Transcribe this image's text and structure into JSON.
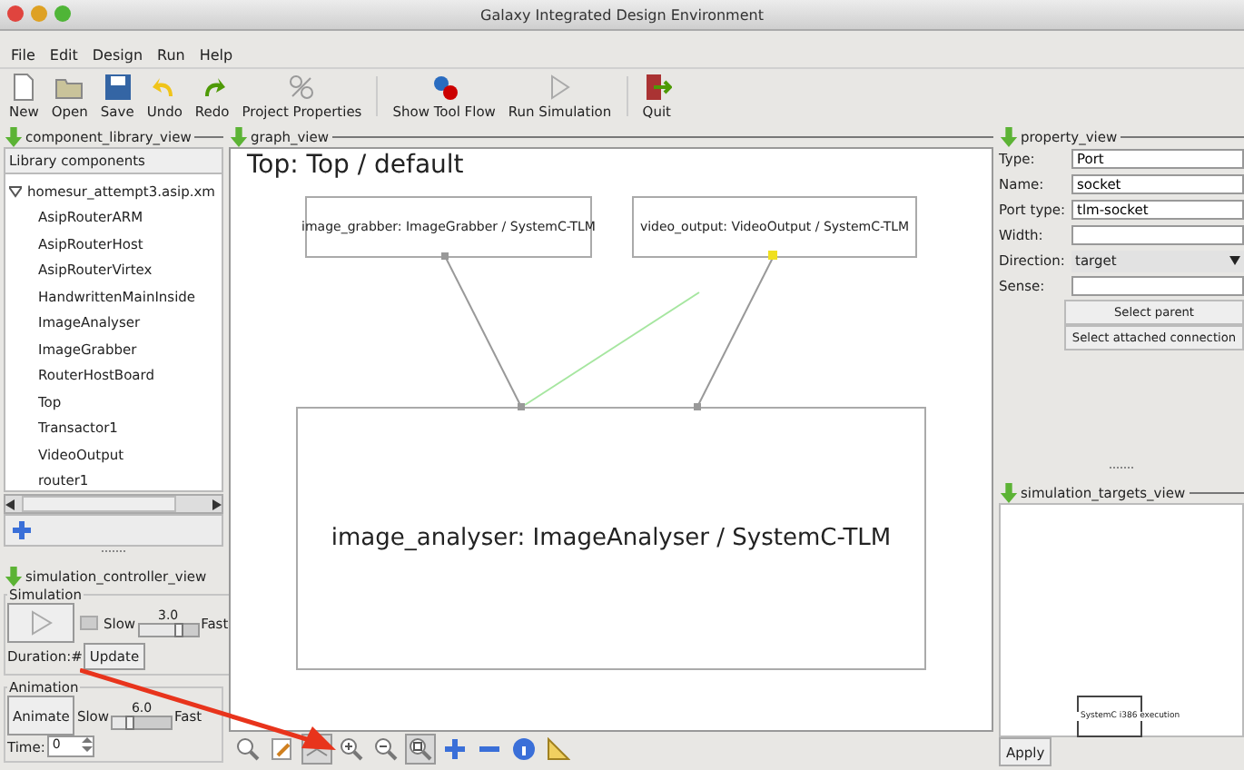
{
  "window": {
    "title": "Galaxy Integrated Design Environment"
  },
  "menu": [
    "File",
    "Edit",
    "Design",
    "Run",
    "Help"
  ],
  "toolbar": [
    {
      "label": "New",
      "disabled": false
    },
    {
      "label": "Open",
      "disabled": false
    },
    {
      "label": "Save",
      "disabled": false
    },
    {
      "label": "Undo",
      "disabled": false
    },
    {
      "label": "Redo",
      "disabled": false
    },
    {
      "label": "Project Properties",
      "disabled": false
    },
    {
      "label": "Show Tool Flow",
      "disabled": false
    },
    {
      "label": "Run Simulation",
      "disabled": false
    },
    {
      "label": "Quit",
      "disabled": false
    }
  ],
  "library": {
    "title": "component_library_view",
    "heading": "Library components",
    "tree": [
      {
        "label": "homesur_attempt3.asip.xm",
        "expanded": true,
        "children": [
          {
            "label": "AsipRouterARM"
          },
          {
            "label": "AsipRouterHost"
          },
          {
            "label": "AsipRouterVirtex"
          },
          {
            "label": "HandwrittenMainInside"
          },
          {
            "label": "ImageAnalyser"
          },
          {
            "label": "ImageGrabber"
          },
          {
            "label": "RouterHostBoard"
          },
          {
            "label": "Top"
          },
          {
            "label": "Transactor1"
          },
          {
            "label": "VideoOutput"
          },
          {
            "label": "router1"
          }
        ]
      }
    ]
  },
  "simulation_controller": {
    "title": "simulation_controller_view",
    "simulation": {
      "title": "Simulation",
      "slow": "Slow",
      "fast": "Fast",
      "reading": "3.0",
      "level": 0.7,
      "duration": "Duration:#",
      "update": "Update"
    },
    "animation": {
      "title": "Animation",
      "button": "Animate",
      "slow": "Slow",
      "fast": "Fast",
      "reading": "6.0",
      "level": 0.3,
      "time_label": "Time:",
      "time_value": "0"
    }
  },
  "graph": {
    "title": "graph_view",
    "heading": "Top: Top / default",
    "nodes": [
      {
        "label": "image_grabber: ImageGrabber / SystemC-TLM"
      },
      {
        "label": "video_output: VideoOutput / SystemC-TLM"
      },
      {
        "label": "image_analyser: ImageAnalyser / SystemC-TLM"
      }
    ],
    "tools": [
      {
        "selected": false
      },
      {
        "selected": false
      },
      {
        "selected": true
      },
      {
        "selected": false
      },
      {
        "selected": false
      },
      {
        "selected": true
      },
      {
        "selected": false
      },
      {
        "selected": false
      },
      {
        "selected": false
      },
      {
        "selected": false
      }
    ]
  },
  "properties": {
    "title": "property_view",
    "fields": [
      {
        "label": "Type:",
        "value": "Port",
        "kind": "text"
      },
      {
        "label": "Name:",
        "value": "socket",
        "kind": "text"
      },
      {
        "label": "Port type:",
        "value": "tlm-socket",
        "kind": "text"
      },
      {
        "label": "Width:",
        "kind": "text"
      },
      {
        "label": "Direction:",
        "value": "target",
        "kind": "dropdown"
      },
      {
        "label": "Sense:",
        "kind": "text"
      }
    ],
    "buttons": [
      "Select parent",
      "Select attached connection"
    ]
  },
  "simulation_targets": {
    "title": "simulation_targets_view",
    "target": "SystemC i386 execution",
    "apply": "Apply"
  }
}
